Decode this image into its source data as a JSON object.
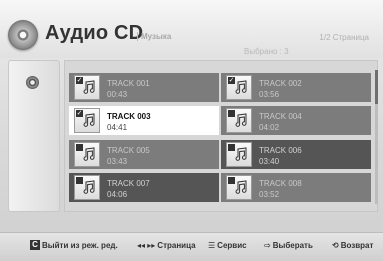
{
  "header": {
    "title": "Аудио CD",
    "category": "Музыка",
    "page": "1/2 Страница",
    "selected": "Выбрано : 3"
  },
  "tracks": [
    {
      "title": "TRACK 001",
      "duration": "00:43",
      "checked": true
    },
    {
      "title": "TRACK 002",
      "duration": "03:56",
      "checked": true
    },
    {
      "title": "TRACK 003",
      "duration": "04:41",
      "checked": true
    },
    {
      "title": "TRACK 004",
      "duration": "04:02",
      "checked": false
    },
    {
      "title": "TRACK 005",
      "duration": "03:43",
      "checked": false
    },
    {
      "title": "TRACK 006",
      "duration": "03:40",
      "checked": false
    },
    {
      "title": "TRACK 007",
      "duration": "04:06",
      "checked": false
    },
    {
      "title": "TRACK 008",
      "duration": "03:52",
      "checked": false
    }
  ],
  "footer": {
    "edit_key": "C",
    "exit_edit": "Выйти из реж. ред.",
    "page_glyph": "◂◂ ▸▸",
    "page": "Страница",
    "tools_glyph": "☰",
    "tools": "Сервис",
    "select_glyph": "⇨",
    "select": "Выберать",
    "return_glyph": "⟲",
    "return": "Возврат"
  }
}
